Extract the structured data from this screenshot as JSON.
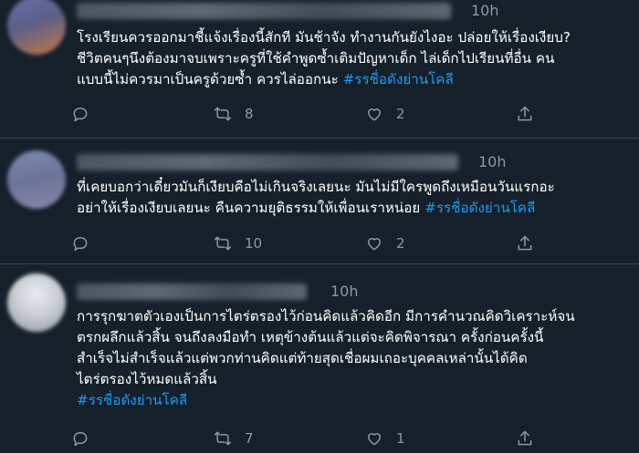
{
  "tweets": [
    {
      "time": "10h",
      "lines": [
        "โรงเรียนควรออกมาชี้แจ้งเรื่องนี้สักที มันช้าจัง ทำงานกันยังไงอะ ปล่อยให้เรื่องเงียบ?",
        "ชีวิตคนๆนึงต้องมาจบเพราะครูที่ใช้คำพูดซ้ำเติมปัญหาเด็ก ไล่เด็กไปเรียนที่อื่น คน"
      ],
      "last_line_text": "แบบนี้ไม่ควรมาเป็นครูด้วยซ้ำ ควรไล่ออกนะ ",
      "hashtag": "#รรชื่อดังย่านโคลี",
      "retweets": "8",
      "likes": "2"
    },
    {
      "time": "10h",
      "lines": [
        "ที่เคยบอกว่าเดี๋ยวมันก็เงียบคือไม่เกินจริงเลยนะ มันไม่มีใครพูดถึงเหมือนวันแรกอะ"
      ],
      "last_line_text": "อย่าให้เรื่องเงียบเลยนะ คืนความยุติธรรมให้เพื่อนเราหน่อย ",
      "hashtag": "#รรชื่อดังย่านโคลี",
      "retweets": "10",
      "likes": "2"
    },
    {
      "time": "10h",
      "lines": [
        "การรุกฆาตตัวเองเป็นการไตร่ตรองไว้ก่อนคิดแล้วคิดอีก มีการคำนวณคิดวิเคราะห์จน",
        "ตรกผลึกแล้วสิ้น จนถึงลงมือทำ เหตุข้างต้นแล้วแต่จะคิดพิจารณา ครั้งก่อนครั้งนี้",
        "สำเร็จไม่สำเร็จแล้วแต่พวกท่านคิดแต่ท้ายสุดเชื่อผมเถอะบุคคลเหล่านั้นได้คิด",
        "ไตร่ตรองไว้หมดแล้วสิ้น"
      ],
      "last_line_text": "",
      "hashtag": "#รรชื่อดังย่านโคลี",
      "retweets": "7",
      "likes": "1"
    }
  ],
  "icons": {
    "reply": "reply-icon",
    "retweet": "retweet-icon",
    "like": "heart-icon",
    "share": "share-icon"
  },
  "colors": {
    "background": "#15202b",
    "text": "#ffffff",
    "muted": "#8b98a5",
    "hashtag": "#1d9bf0",
    "divider": "#38444d"
  }
}
